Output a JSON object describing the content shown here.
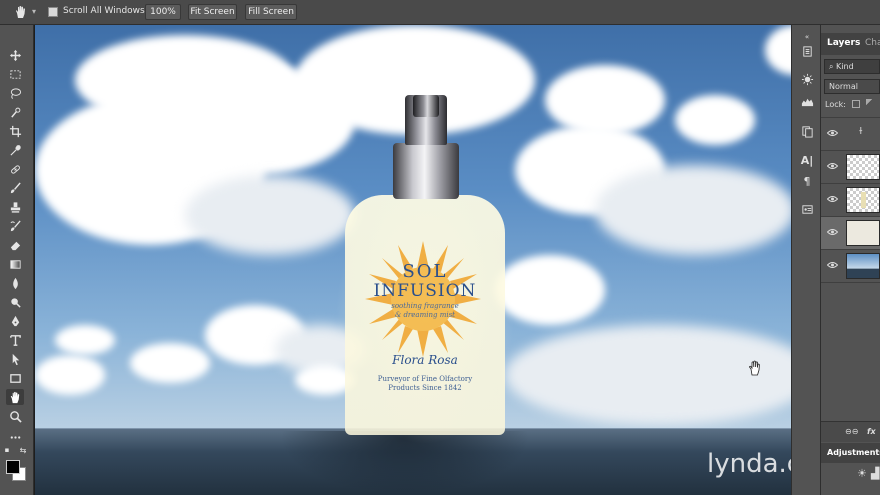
{
  "options_bar": {
    "scroll_all_windows_label": "Scroll All Windows",
    "zoom_button": "100%",
    "fit_screen_button": "Fit Screen",
    "fill_screen_button": "Fill Screen",
    "scroll_all_checked": true
  },
  "tools": [
    "move",
    "marquee",
    "lasso",
    "quick-select",
    "crop",
    "eyedropper",
    "healing",
    "brush",
    "stamp",
    "history-brush",
    "eraser",
    "gradient",
    "blur",
    "dodge",
    "pen",
    "type",
    "path-select",
    "shape",
    "hand",
    "zoom",
    "more"
  ],
  "active_tool": "hand",
  "artwork": {
    "brand_line1": "SOL",
    "brand_line2": "INFUSION",
    "tagline1": "soothing fragrance",
    "tagline2": "& dreaming mist",
    "signature": "Flora Rosa",
    "footer1": "Purveyor of Fine Olfactory",
    "footer2": "Products Since 1842"
  },
  "watermark": "lynda.com",
  "layers_panel": {
    "tab_layers": "Layers",
    "tab_channels": "Cha",
    "kind_filter": "Kind",
    "blend_mode": "Normal",
    "lock_label": "Lock:",
    "adjustments_label": "Adjustments"
  },
  "colors": {
    "ui_dark": "#535353",
    "accent_blue": "#2a4f8c",
    "sun_orange": "#f0a733"
  }
}
